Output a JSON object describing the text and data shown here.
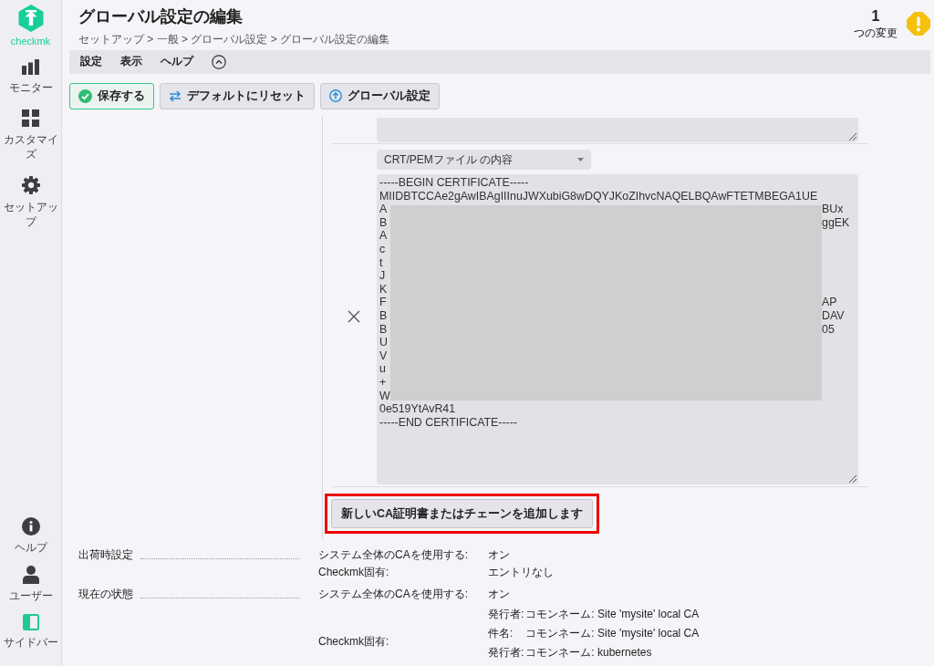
{
  "sidebar": {
    "logo_text": "checkmk",
    "items": [
      {
        "label": "モニター",
        "kind": "monitor"
      },
      {
        "label": "カスタマイズ",
        "kind": "customize"
      },
      {
        "label": "セットアップ",
        "kind": "setup"
      }
    ],
    "bottom_items": [
      {
        "label": "ヘルプ",
        "kind": "help"
      },
      {
        "label": "ユーザー",
        "kind": "user"
      },
      {
        "label": "サイドバー",
        "kind": "sidebar"
      }
    ]
  },
  "header": {
    "title": "グローバル設定の編集",
    "breadcrumb": "セットアップ > 一般 > グローバル設定 > グローバル設定の編集",
    "changes": {
      "count": "1",
      "label": "つの変更"
    }
  },
  "menu": [
    {
      "label": "設定"
    },
    {
      "label": "表示"
    },
    {
      "label": "ヘルプ"
    }
  ],
  "toolbar": [
    {
      "label": "保存する",
      "kind": "save"
    },
    {
      "label": "デフォルトにリセット",
      "kind": "reset"
    },
    {
      "label": "グローバル設定",
      "kind": "global"
    }
  ],
  "ca_editor": {
    "dropdown": {
      "value": "CRT/PEMファイル の内容"
    },
    "certificate": {
      "lines_before": [
        "-----BEGIN CERTIFICATE-----",
        "MIIDBTCCAe2gAwIBAgIIInuJWXubiG8wDQYJKoZIhvcNAQELBQAwFTETMBEGA1UE"
      ],
      "redacted_lines": [
        {
          "start": "A",
          "end": "BUx"
        },
        {
          "start": "B",
          "end": "ggEK"
        },
        {
          "start": "A"
        },
        {
          "start": "c"
        },
        {
          "start": "t"
        },
        {
          "start": "J"
        },
        {
          "start": "K"
        },
        {
          "start": "F",
          "end": "AP"
        },
        {
          "start": "B",
          "end": "DAV"
        },
        {
          "start": "B",
          "end": "05"
        },
        {
          "start": "U"
        },
        {
          "start": "V"
        },
        {
          "start": "u"
        },
        {
          "start": "+"
        },
        {
          "start": "W"
        }
      ],
      "lines_after": [
        "0e519YtAvR41",
        "-----END CERTIFICATE-----"
      ]
    },
    "add_button": "新しいCA証明書またはチェーンを追加します",
    "highlighted": true
  },
  "settings": [
    {
      "label": "出荷時設定",
      "rows": [
        {
          "kind": "value",
          "key": "システム全体のCAを使用する:",
          "value": "オン"
        },
        {
          "kind": "value",
          "key": "Checkmk固有:",
          "value": "エントリなし"
        }
      ]
    },
    {
      "label": "現在の状態",
      "rows": [
        {
          "kind": "value",
          "key": "システム全体のCAを使用する:",
          "value": "オン"
        },
        {
          "kind": "entries",
          "key": "Checkmk固有:",
          "entries": [
            {
              "key": "発行者:",
              "value": "コモンネーム: Site 'mysite' local CA"
            },
            {
              "key": "件名:",
              "value": "コモンネーム: Site 'mysite' local CA"
            },
            {
              "key": "発行者:",
              "value": "コモンネーム: kubernetes"
            }
          ]
        }
      ]
    }
  ]
}
